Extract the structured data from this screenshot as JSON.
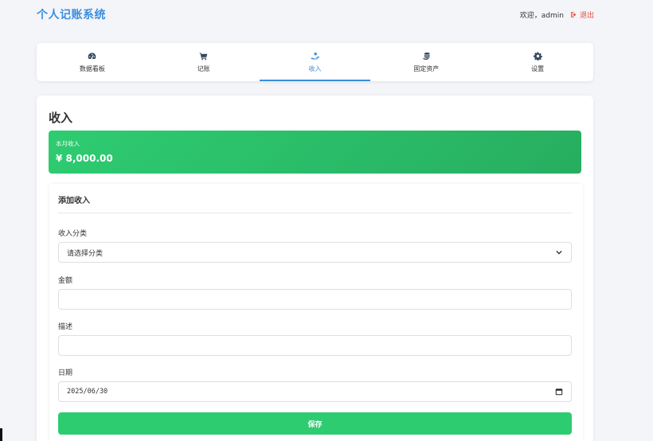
{
  "header": {
    "brand": "个人记账系统",
    "welcome": "欢迎，admin",
    "logout_label": "退出"
  },
  "nav": {
    "items": [
      {
        "label": "数据看板",
        "icon": "dashboard-icon"
      },
      {
        "label": "记账",
        "icon": "cart-icon"
      },
      {
        "label": "收入",
        "icon": "hand-holding-money-icon",
        "active": true
      },
      {
        "label": "固定资产",
        "icon": "coins-icon"
      },
      {
        "label": "设置",
        "icon": "gear-icon"
      }
    ]
  },
  "page": {
    "title": "收入",
    "summary_label": "本月收入",
    "summary_value": "¥ 8,000.00"
  },
  "form": {
    "title": "添加收入",
    "category_label": "收入分类",
    "category_value": "请选择分类",
    "amount_label": "金额",
    "amount_value": "",
    "description_label": "描述",
    "description_value": "",
    "date_label": "日期",
    "date_value": "2025/06/30",
    "save_label": "保存"
  },
  "colors": {
    "brand": "#3a8ee0",
    "success": "#2ecc71",
    "danger": "#e74c3c"
  }
}
